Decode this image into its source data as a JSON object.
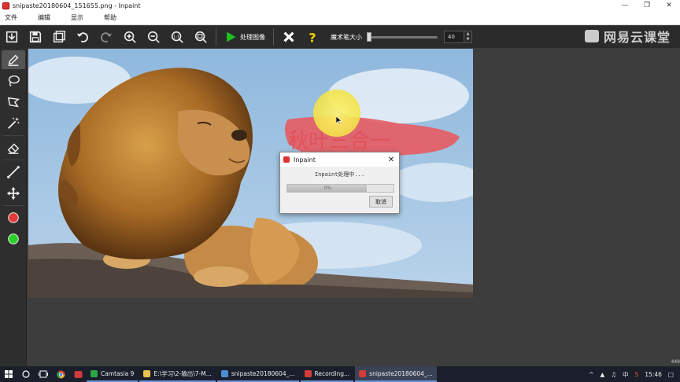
{
  "window": {
    "title": "snipaste20180604_151655.png - Inpaint"
  },
  "menu": [
    "文件",
    "编辑",
    "显示",
    "帮助"
  ],
  "toolbar": {
    "process_label": "处理图像",
    "brush_size_label": "魔术笔大小",
    "brush_size_value": "40",
    "brush_size_fraction": 0.0
  },
  "watermark": {
    "text": "网易云课堂"
  },
  "canvas": {
    "overlay_text": "秋叶三合一"
  },
  "dialog": {
    "title": "Inpaint",
    "message": "Inpaint处理中...",
    "progress_text": "0%",
    "progress_fraction": 0.75,
    "cancel_label": "取消"
  },
  "edge_number": "449",
  "taskbar": {
    "items": [
      {
        "label": "Camtasia 9",
        "color": "#2aa843"
      },
      {
        "label": "E:\\学习\\2-输出\\7-M...",
        "color": "#e8c24a"
      },
      {
        "label": "snipaste20180604_...",
        "color": "#4a8fd6"
      },
      {
        "label": "Recording...",
        "color": "#d33c3c"
      },
      {
        "label": "snipaste20180604_...",
        "color": "#d33c3c"
      }
    ],
    "tray_ime": "中",
    "clock": "15:46"
  },
  "colors": {
    "accent_green": "#1ec41e",
    "close_white": "#ffffff",
    "help_yellow": "#f0d000",
    "red_marker": "#e23b3b",
    "green_marker": "#2ad12a"
  }
}
